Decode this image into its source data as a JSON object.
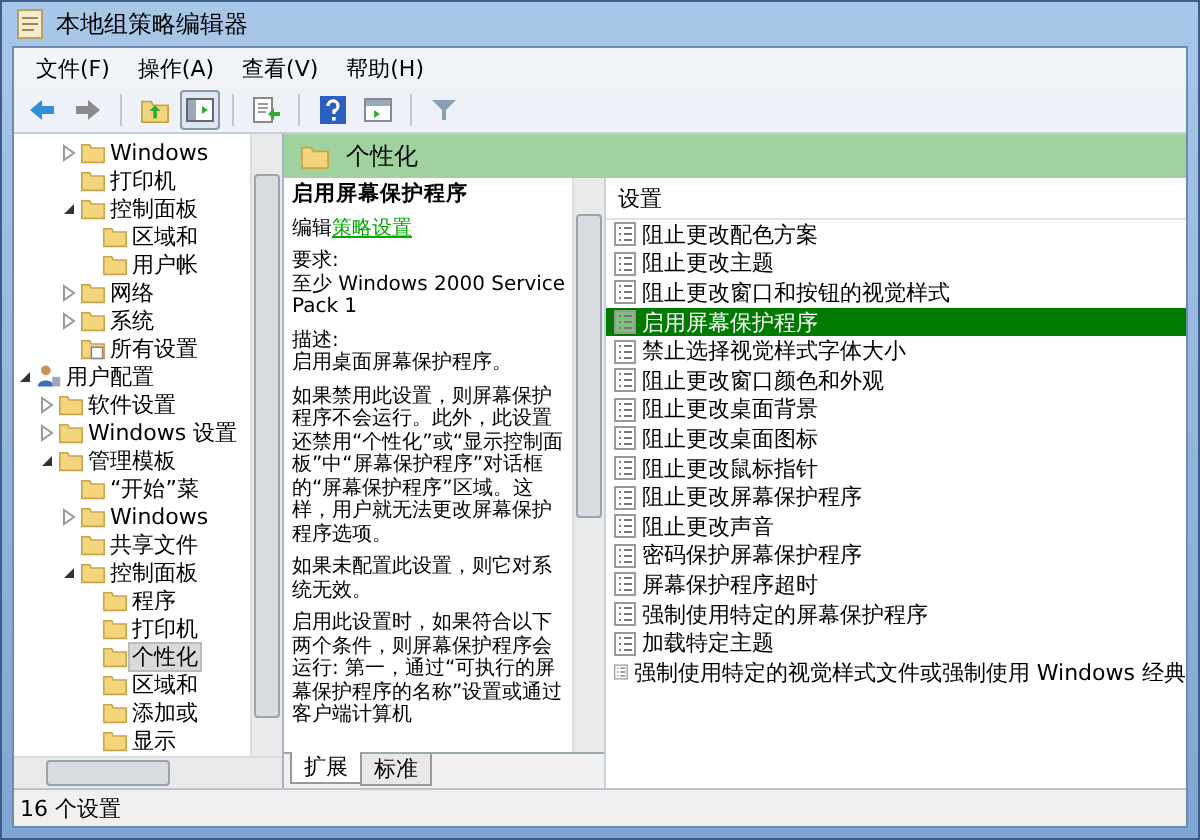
{
  "window": {
    "title": "本地组策略编辑器"
  },
  "menu": [
    "文件(F)",
    "操作(A)",
    "查看(V)",
    "帮助(H)"
  ],
  "tree": {
    "upper_items": [
      {
        "label": "Windows",
        "kind": "folder",
        "expanded": false,
        "selected": false
      },
      {
        "label": "打印机",
        "kind": "folder",
        "selected": false
      },
      {
        "label": "控制面板",
        "kind": "folder",
        "expanded": true,
        "selected": false,
        "children": [
          {
            "label": "区域和",
            "kind": "folder",
            "selected": false
          },
          {
            "label": "用户帐",
            "kind": "folder",
            "selected": false
          }
        ]
      },
      {
        "label": "网络",
        "kind": "folder",
        "expanded": false,
        "selected": false
      },
      {
        "label": "系统",
        "kind": "folder",
        "expanded": false,
        "selected": false
      },
      {
        "label": "所有设置",
        "kind": "settings",
        "selected": false
      }
    ],
    "items": [
      {
        "label": "用户配置",
        "kind": "user",
        "expanded": true,
        "selected": false,
        "children": [
          {
            "label": "软件设置",
            "kind": "folder",
            "expanded": false,
            "selected": false
          },
          {
            "label": "Windows 设置",
            "kind": "folder",
            "expanded": false,
            "selected": false
          },
          {
            "label": "管理模板",
            "kind": "folder",
            "expanded": true,
            "selected": false,
            "children": [
              {
                "label": "“开始”菜",
                "kind": "folder",
                "selected": false
              },
              {
                "label": "Windows",
                "kind": "folder",
                "expanded": false,
                "selected": false
              },
              {
                "label": "共享文件",
                "kind": "folder",
                "selected": false
              },
              {
                "label": "控制面板",
                "kind": "folder",
                "expanded": true,
                "selected": false,
                "children": [
                  {
                    "label": "程序",
                    "kind": "folder",
                    "selected": false
                  },
                  {
                    "label": "打印机",
                    "kind": "folder",
                    "selected": false
                  },
                  {
                    "label": "个性化",
                    "kind": "folder",
                    "selected": true
                  },
                  {
                    "label": "区域和",
                    "kind": "folder",
                    "selected": false
                  },
                  {
                    "label": "添加或",
                    "kind": "folder",
                    "selected": false
                  },
                  {
                    "label": "显示",
                    "kind": "folder",
                    "selected": false
                  }
                ]
              }
            ]
          }
        ]
      }
    ]
  },
  "header": {
    "title": "个性化"
  },
  "description": {
    "title": "启用屏幕保护程序",
    "edit_prefix": "编辑",
    "edit_link": "策略设置",
    "requirements_label": "要求:",
    "requirements": "至少 Windows 2000 Service Pack 1",
    "description_label": "描述:",
    "description": "启用桌面屏幕保护程序。",
    "paragraphs": [
      "如果禁用此设置，则屏幕保护程序不会运行。此外，此设置还禁用“个性化”或“显示控制面板”中“屏幕保护程序”对话框的“屏幕保护程序”区域。这样，用户就无法更改屏幕保护程序选项。",
      "如果未配置此设置，则它对系统无效。",
      "启用此设置时，如果符合以下两个条件，则屏幕保护程序会运行: 第一，通过“可执行的屏幕保护程序的名称”设置或通过客户端计算机"
    ]
  },
  "settings": {
    "column": "设置",
    "rows": [
      {
        "label": "阻止更改配色方案",
        "selected": false
      },
      {
        "label": "阻止更改主题",
        "selected": false
      },
      {
        "label": "阻止更改窗口和按钮的视觉样式",
        "selected": false
      },
      {
        "label": "启用屏幕保护程序",
        "selected": true
      },
      {
        "label": "禁止选择视觉样式字体大小",
        "selected": false
      },
      {
        "label": "阻止更改窗口颜色和外观",
        "selected": false
      },
      {
        "label": "阻止更改桌面背景",
        "selected": false
      },
      {
        "label": "阻止更改桌面图标",
        "selected": false
      },
      {
        "label": "阻止更改鼠标指针",
        "selected": false
      },
      {
        "label": "阻止更改屏幕保护程序",
        "selected": false
      },
      {
        "label": "阻止更改声音",
        "selected": false
      },
      {
        "label": "密码保护屏幕保护程序",
        "selected": false
      },
      {
        "label": "屏幕保护程序超时",
        "selected": false
      },
      {
        "label": "强制使用特定的屏幕保护程序",
        "selected": false
      },
      {
        "label": "加载特定主题",
        "selected": false
      },
      {
        "label": "强制使用特定的视觉样式文件或强制使用 Windows 经典",
        "selected": false
      }
    ]
  },
  "tabs": [
    {
      "label": "扩展",
      "selected": true
    },
    {
      "label": "标准",
      "selected": false
    }
  ],
  "status_bar": "16 个设置"
}
